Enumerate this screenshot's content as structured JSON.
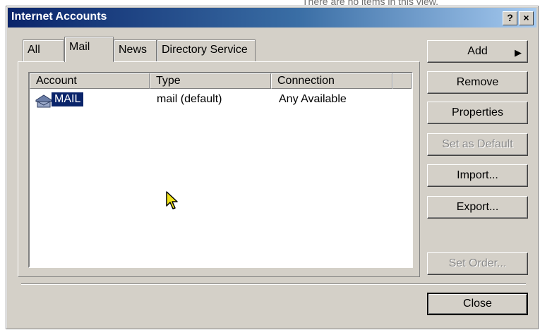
{
  "background": {
    "partial_text": "There are no items in this view."
  },
  "window": {
    "title": "Internet Accounts",
    "help_label": "?",
    "close_label": "×"
  },
  "tabs": [
    {
      "label": "All",
      "active": false
    },
    {
      "label": "Mail",
      "active": true
    },
    {
      "label": "News",
      "active": false
    },
    {
      "label": "Directory Service",
      "active": false
    }
  ],
  "list": {
    "columns": [
      "Account",
      "Type",
      "Connection"
    ],
    "rows": [
      {
        "account": "MAIL",
        "type": "mail (default)",
        "connection": "Any Available",
        "selected": true
      }
    ]
  },
  "buttons": {
    "add": "Add",
    "remove": "Remove",
    "properties": "Properties",
    "set_default": "Set as Default",
    "import": "Import...",
    "export": "Export...",
    "set_order": "Set Order...",
    "close": "Close"
  },
  "colors": {
    "titlebar_start": "#0a246a",
    "titlebar_end": "#a6caf0",
    "face": "#d4d0c8",
    "selection": "#0a246a"
  }
}
